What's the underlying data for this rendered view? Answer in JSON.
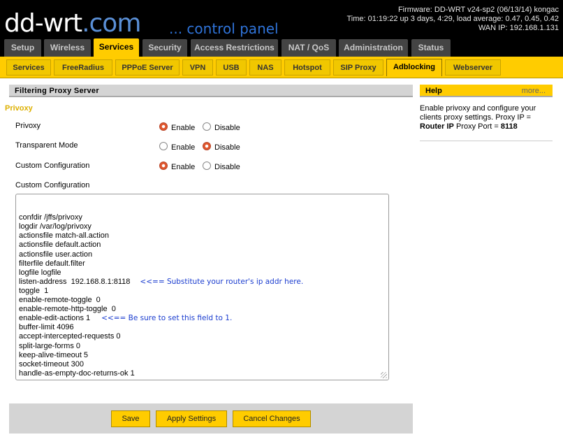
{
  "header": {
    "logo_text": "dd-wrt",
    "logo_suffix": ".com",
    "tagline": "... control panel",
    "firmware": "Firmware: DD-WRT v24-sp2 (06/13/14) kongac",
    "time": "Time: 01:19:22 up 3 days, 4:29, load average: 0.47, 0.45, 0.42",
    "wan_ip": "WAN IP: 192.168.1.131"
  },
  "main_tabs": [
    "Setup",
    "Wireless",
    "Services",
    "Security",
    "Access Restrictions",
    "NAT / QoS",
    "Administration",
    "Status"
  ],
  "sub_tabs": [
    "Services",
    "FreeRadius",
    "PPPoE Server",
    "VPN",
    "USB",
    "NAS",
    "Hotspot",
    "SIP Proxy",
    "Adblocking",
    "Webserver"
  ],
  "section_title": "Filtering Proxy Server",
  "fieldset_legend": "Privoxy",
  "settings": {
    "privoxy": {
      "label": "Privoxy",
      "enable": "Enable",
      "disable": "Disable",
      "selected": "Enable"
    },
    "transparent": {
      "label": "Transparent Mode",
      "enable": "Enable",
      "disable": "Disable",
      "selected": "Disable"
    },
    "custom": {
      "label": "Custom Configuration",
      "enable": "Enable",
      "disable": "Disable",
      "selected": "Enable"
    }
  },
  "custom_config_label": "Custom Configuration",
  "custom_config_lines": [
    {
      "text": "confdir /jffs/privoxy",
      "note": ""
    },
    {
      "text": "logdir /var/log/privoxy",
      "note": ""
    },
    {
      "text": "actionsfile match-all.action",
      "note": ""
    },
    {
      "text": "actionsfile default.action",
      "note": ""
    },
    {
      "text": "actionsfile user.action",
      "note": ""
    },
    {
      "text": "filterfile default.filter",
      "note": ""
    },
    {
      "text": "logfile logfile",
      "note": ""
    },
    {
      "text": "listen-address  192.168.8.1:8118",
      "note": "<<== Substitute your router's ip addr here."
    },
    {
      "text": "toggle  1",
      "note": ""
    },
    {
      "text": "enable-remote-toggle  0",
      "note": ""
    },
    {
      "text": "enable-remote-http-toggle  0",
      "note": ""
    },
    {
      "text": "enable-edit-actions 1",
      "note": "<<== Be sure to set this field to 1."
    },
    {
      "text": "buffer-limit 4096",
      "note": ""
    },
    {
      "text": "accept-intercepted-requests 0",
      "note": ""
    },
    {
      "text": "split-large-forms 0",
      "note": ""
    },
    {
      "text": "keep-alive-timeout 5",
      "note": ""
    },
    {
      "text": "socket-timeout 300",
      "note": ""
    },
    {
      "text": "handle-as-empty-doc-returns-ok 1",
      "note": ""
    }
  ],
  "buttons": {
    "save": "Save",
    "apply": "Apply Settings",
    "cancel": "Cancel Changes"
  },
  "help": {
    "title": "Help",
    "more": "more...",
    "text_before": "Enable privoxy and configure your clients proxy settings. Proxy IP = ",
    "router_ip": "Router IP",
    "text_middle": " Proxy Port = ",
    "port": "8118"
  },
  "colors": {
    "accent": "#ffcc00",
    "tab_bg": "#444444",
    "note_blue": "#1a3ccf",
    "legend": "#ddb000"
  }
}
